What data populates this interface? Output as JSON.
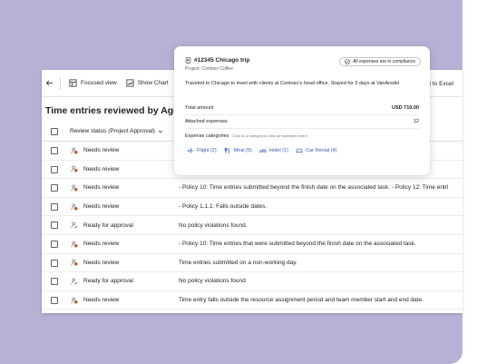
{
  "toolbar": {
    "back_icon": "arrow-left-icon",
    "focused_view": "Focused view",
    "show_chart": "Show Chart",
    "export_partial": "t to Excel"
  },
  "page": {
    "title": "Time entries reviewed by Agent"
  },
  "table": {
    "header": {
      "review_status": "Review status (Project Approval)"
    },
    "rows": [
      {
        "status": "Needs review",
        "description": ""
      },
      {
        "status": "Needs review",
        "description": ""
      },
      {
        "status": "Needs review",
        "description": "- Policy 10: Time entries submitted beyond the finish date on the associated task. - Policy 12: Time entri"
      },
      {
        "status": "Needs review",
        "description": "- Policy 1.1.1: Falls outside dates."
      },
      {
        "status": "Ready for approval",
        "description": "No policy violations found."
      },
      {
        "status": "Needs review",
        "description": "- Policy 10: Time entries that were submitted beyond the finish date on the associated task."
      },
      {
        "status": "Needs review",
        "description": "Time entries submitted on a non-working day."
      },
      {
        "status": "Ready for approval",
        "description": "No policy violations found."
      },
      {
        "status": "Needs review",
        "description": "Time entry falls outside the resource assignment period and team member start and end date."
      }
    ]
  },
  "card": {
    "trip_title": "#12345 Chicago trip",
    "project": "Project: Contoso Coffee",
    "compliance_badge": "All expenses are in compliance",
    "description": "Traveled to Chicago to meet with clients at Contoso's head office. Stayed for 3 days at VanArsdel",
    "total_label": "Total amount",
    "total_value": "USD 710.00",
    "attached_label": "Attached expenses",
    "attached_value": "12",
    "categories_title": "Expense categories",
    "categories_hint": "Click on a category to view all expenses from it",
    "chips": [
      {
        "label": "Flight (2)",
        "icon": "airplane-icon"
      },
      {
        "label": "Meal (5)",
        "icon": "food-icon"
      },
      {
        "label": "Hotel (1)",
        "icon": "bed-icon"
      },
      {
        "label": "Car Rental (4)",
        "icon": "car-icon"
      }
    ]
  },
  "colors": {
    "background": "#b9b0d6",
    "accent": "#3b5bb5",
    "status_icon": "#c4572a"
  }
}
